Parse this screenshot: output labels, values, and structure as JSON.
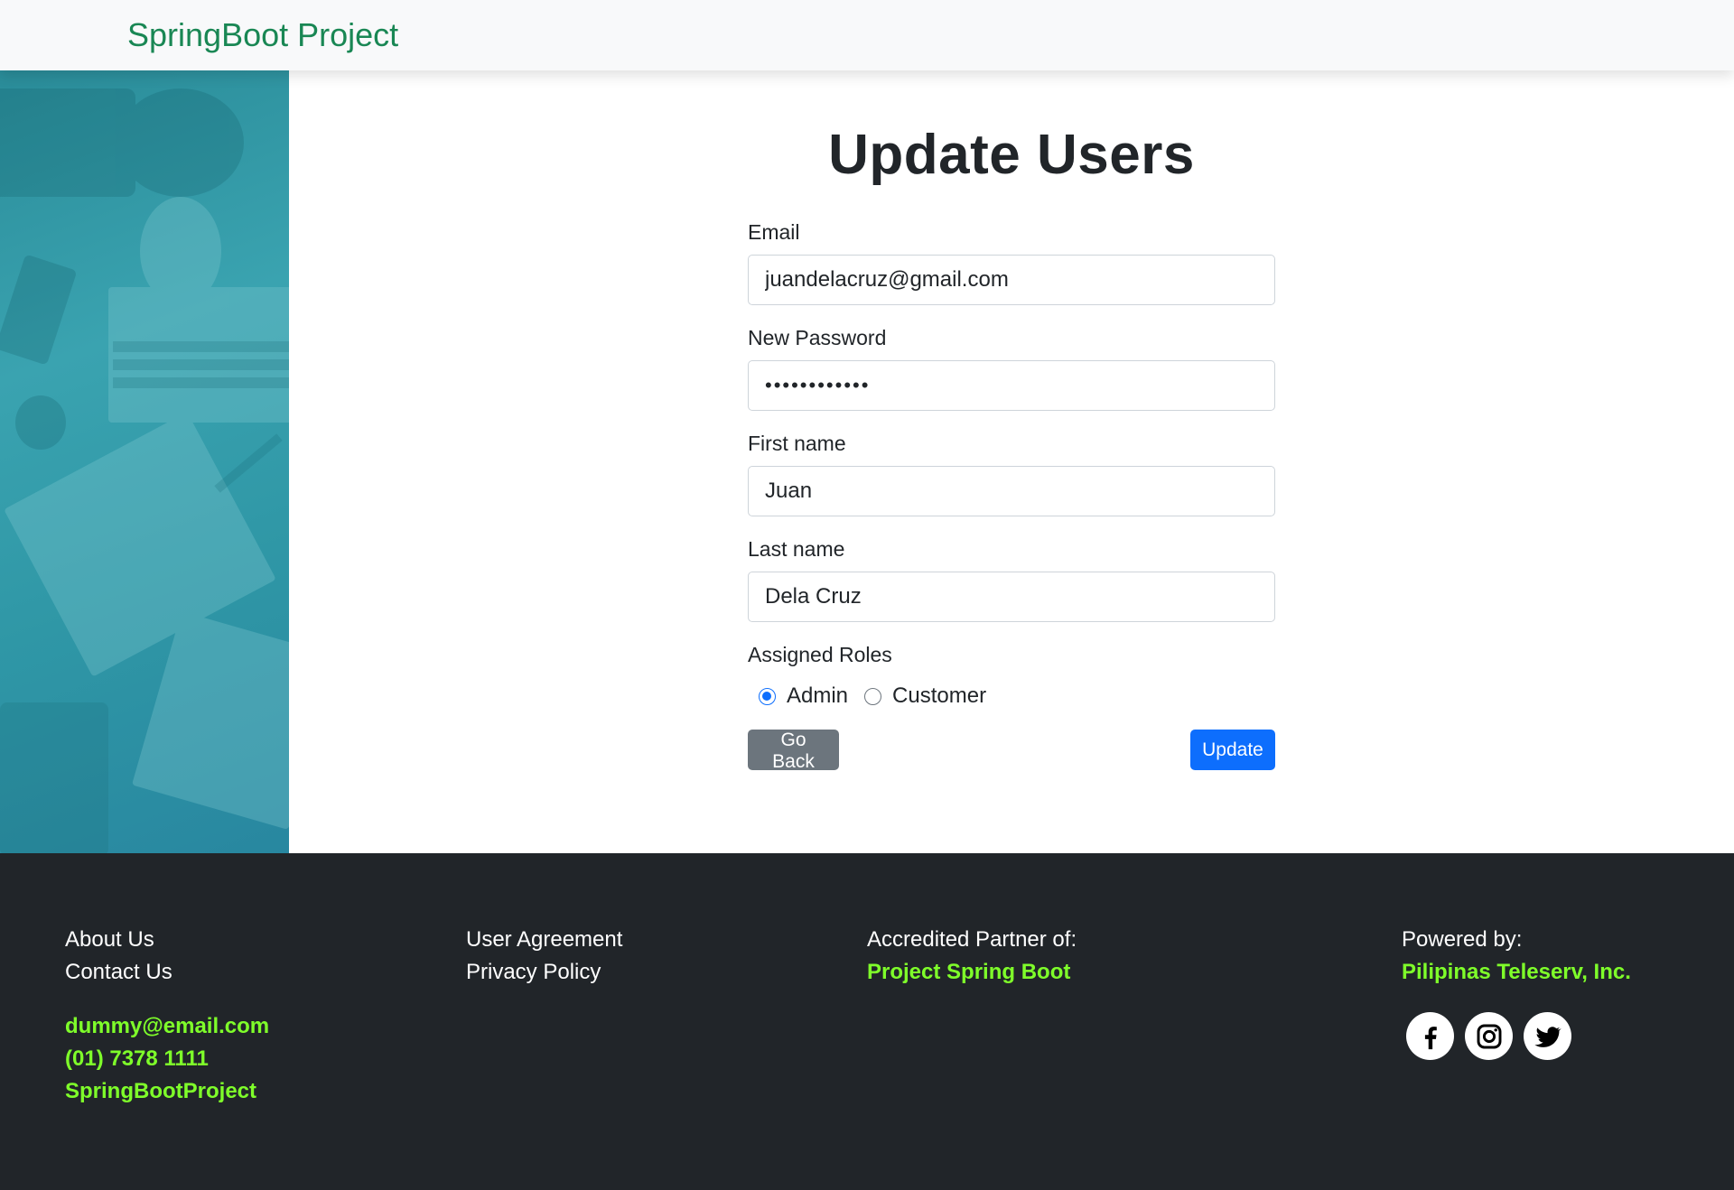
{
  "navbar": {
    "brand": "SpringBoot Project"
  },
  "page": {
    "title": "Update Users"
  },
  "form": {
    "email": {
      "label": "Email",
      "value": "juandelacruz@gmail.com"
    },
    "password": {
      "label": "New Password",
      "value": "••••••••••••"
    },
    "first_name": {
      "label": "First name",
      "value": "Juan"
    },
    "last_name": {
      "label": "Last name",
      "value": "Dela Cruz"
    },
    "roles": {
      "label": "Assigned Roles",
      "options": [
        {
          "label": "Admin",
          "selected": true
        },
        {
          "label": "Customer",
          "selected": false
        }
      ]
    },
    "back_button": "Go Back",
    "update_button": "Update"
  },
  "footer": {
    "col1": {
      "links": [
        "About Us",
        "Contact Us"
      ],
      "email": "dummy@email.com",
      "phone": "(01) 7378 1111",
      "handle": "SpringBootProject"
    },
    "col2": {
      "links": [
        "User Agreement",
        "Privacy Policy"
      ]
    },
    "col3": {
      "label": "Accredited Partner of:",
      "partner": "Project Spring Boot"
    },
    "col4": {
      "label": "Powered by:",
      "company": "Pilipinas Teleserv, Inc.",
      "socials": [
        "facebook-icon",
        "instagram-icon",
        "twitter-icon"
      ]
    }
  },
  "colors": {
    "brand": "#198754",
    "footer_bg": "#212529",
    "footer_accent": "#7fff2a",
    "primary": "#0d6efd",
    "secondary": "#6c757d"
  }
}
